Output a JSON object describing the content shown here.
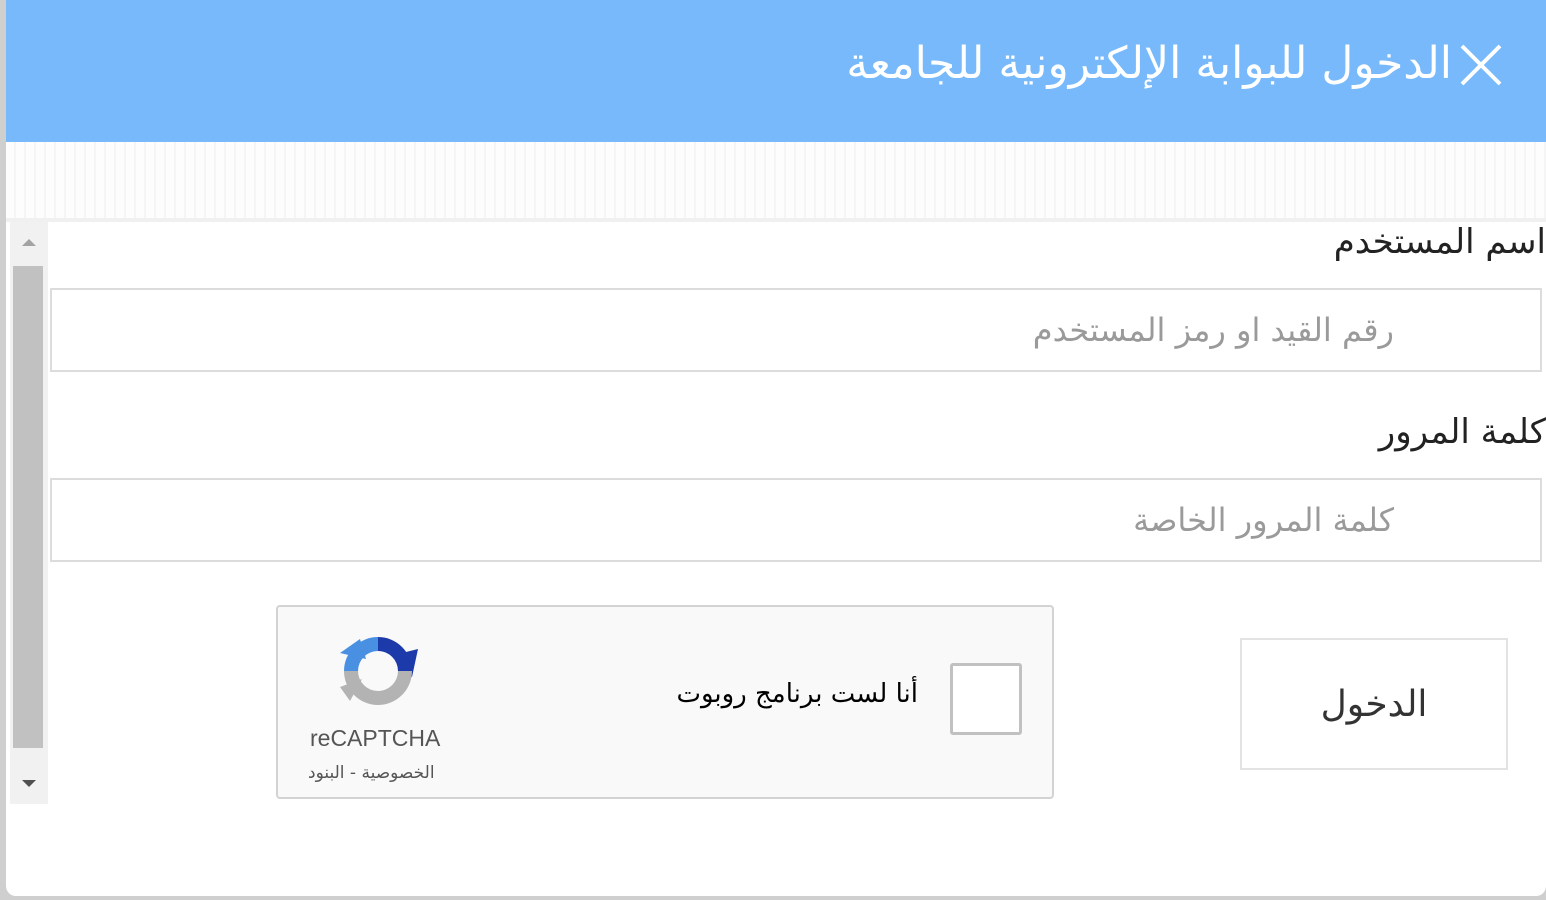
{
  "dialog": {
    "title": "الدخول للبوابة الإلكترونية للجامعة",
    "close_icon": "close-icon"
  },
  "form": {
    "username_label": "اسم المستخدم",
    "username_placeholder": "رقم القيد او رمز المستخدم",
    "username_value": "",
    "password_label": "كلمة المرور",
    "password_placeholder": "كلمة المرور الخاصة",
    "password_value": "",
    "login_button": "الدخول"
  },
  "captcha": {
    "checkbox_label": "أنا لست برنامج روبوت",
    "brand": "reCAPTCHA",
    "privacy_link": "الخصوصية",
    "separator": " - ",
    "terms_link": "البنود",
    "logo_icon": "recaptcha-logo-icon",
    "checked": false
  },
  "colors": {
    "header": "#77b9fb",
    "recaptcha_blue": "#1c3aa9",
    "recaptcha_light_blue": "#4a90e2",
    "recaptcha_gray": "#b3b3b3"
  }
}
